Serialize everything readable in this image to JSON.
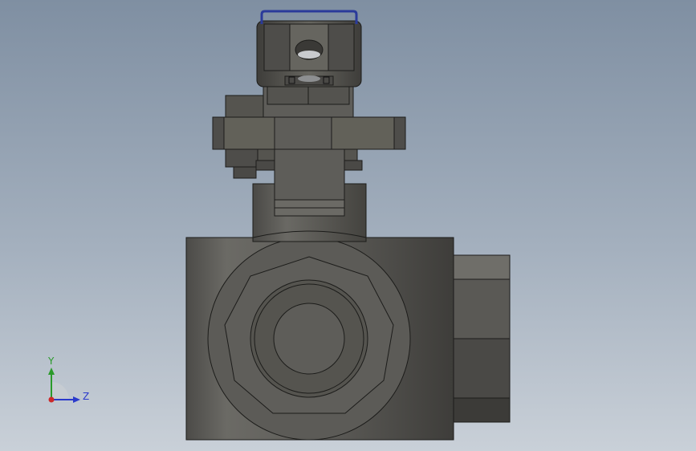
{
  "viewport": {
    "background_top": "#7f8fa2",
    "background_bottom": "#c9d0d8",
    "model": {
      "body_color": "#5a5955",
      "edge_color": "#1c1c1a",
      "highlight_color": "#7a7872",
      "handle_wire_color": "#2a3a9a"
    }
  },
  "triad": {
    "y_label": "Y",
    "z_label": "Z",
    "y_color": "#2a9a2a",
    "z_color": "#2a3acc",
    "x_color": "#cc2a2a"
  }
}
